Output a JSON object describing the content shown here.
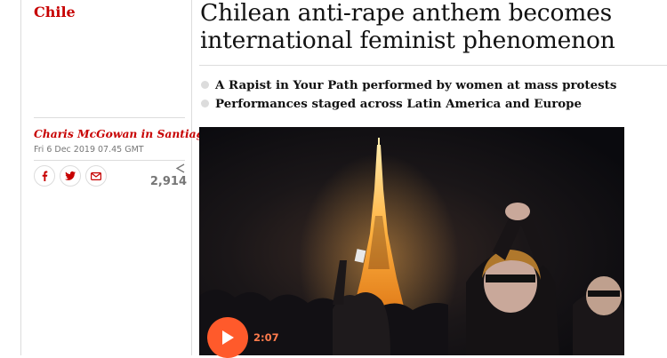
{
  "section": "Chile",
  "headline": "Chilean anti-rape anthem becomes international feminist phenomenon",
  "standfirst": [
    "A Rapist in Your Path performed by women at mass protests",
    "Performances staged across Latin America and Europe"
  ],
  "byline": "Charis McGowan in Santiago",
  "dateline": "Fri 6 Dec 2019 07.45 GMT",
  "share": {
    "count": "2,914",
    "icons": [
      "facebook-icon",
      "twitter-icon",
      "email-icon",
      "share-icon"
    ]
  },
  "video": {
    "duration": "2:07",
    "play_icon": "play-icon"
  },
  "colors": {
    "accent": "#c70000",
    "play_button": "#ff5a2b",
    "rule": "#dcdcdc"
  }
}
